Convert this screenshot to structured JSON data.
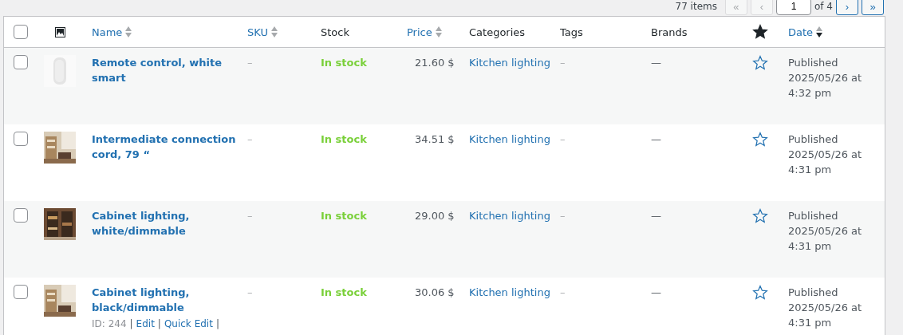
{
  "pagination": {
    "count": "77 items",
    "first": "«",
    "prev": "‹",
    "page": "1",
    "of": "of 4",
    "next": "›",
    "last": "»"
  },
  "table": {
    "all_checked": false,
    "columns": [
      {
        "kind": "checkbox"
      },
      {
        "kind": "image-icon"
      },
      {
        "kind": "text",
        "label": "Name",
        "sortable": true,
        "sorted": false
      },
      {
        "kind": "text",
        "label": "SKU",
        "sortable": true,
        "sorted": false
      },
      {
        "kind": "text",
        "label": "Stock",
        "sortable": false
      },
      {
        "kind": "text",
        "label": "Price",
        "sortable": true,
        "sorted": false
      },
      {
        "kind": "text",
        "label": "Categories",
        "sortable": false
      },
      {
        "kind": "text",
        "label": "Tags",
        "sortable": false
      },
      {
        "kind": "text",
        "label": "Brands",
        "sortable": false
      },
      {
        "kind": "star-icon"
      },
      {
        "kind": "text",
        "label": "Date",
        "sortable": true,
        "sorted": true
      }
    ],
    "rows": [
      {
        "checked": false,
        "name": "Remote control, white smart",
        "sku": "–",
        "stock": "In stock",
        "price": "21.60 $",
        "category": "Kitchen lighting",
        "tags": "–",
        "brands": "—",
        "featured": false,
        "date": "Published 2025/05/26 at 4:32 pm"
      },
      {
        "checked": false,
        "name": "Intermediate connection cord, 79 “",
        "sku": "–",
        "stock": "In stock",
        "price": "34.51 $",
        "category": "Kitchen lighting",
        "tags": "–",
        "brands": "—",
        "featured": false,
        "date": "Published 2025/05/26 at 4:31 pm"
      },
      {
        "checked": false,
        "name": "Cabinet lighting, white/dimmable",
        "sku": "–",
        "stock": "In stock",
        "price": "29.00 $",
        "category": "Kitchen lighting",
        "tags": "–",
        "brands": "—",
        "featured": false,
        "date": "Published 2025/05/26 at 4:31 pm"
      },
      {
        "checked": false,
        "name": "Cabinet lighting, black/dimmable",
        "sku": "–",
        "stock": "In stock",
        "price": "30.06 $",
        "category": "Kitchen lighting",
        "tags": "–",
        "brands": "—",
        "featured": false,
        "date": "Published 2025/05/26 at 4:31 pm",
        "actions": {
          "id": "ID: 244",
          "sep": "|",
          "edit": "Edit",
          "quick": "Quick Edit"
        }
      }
    ]
  }
}
